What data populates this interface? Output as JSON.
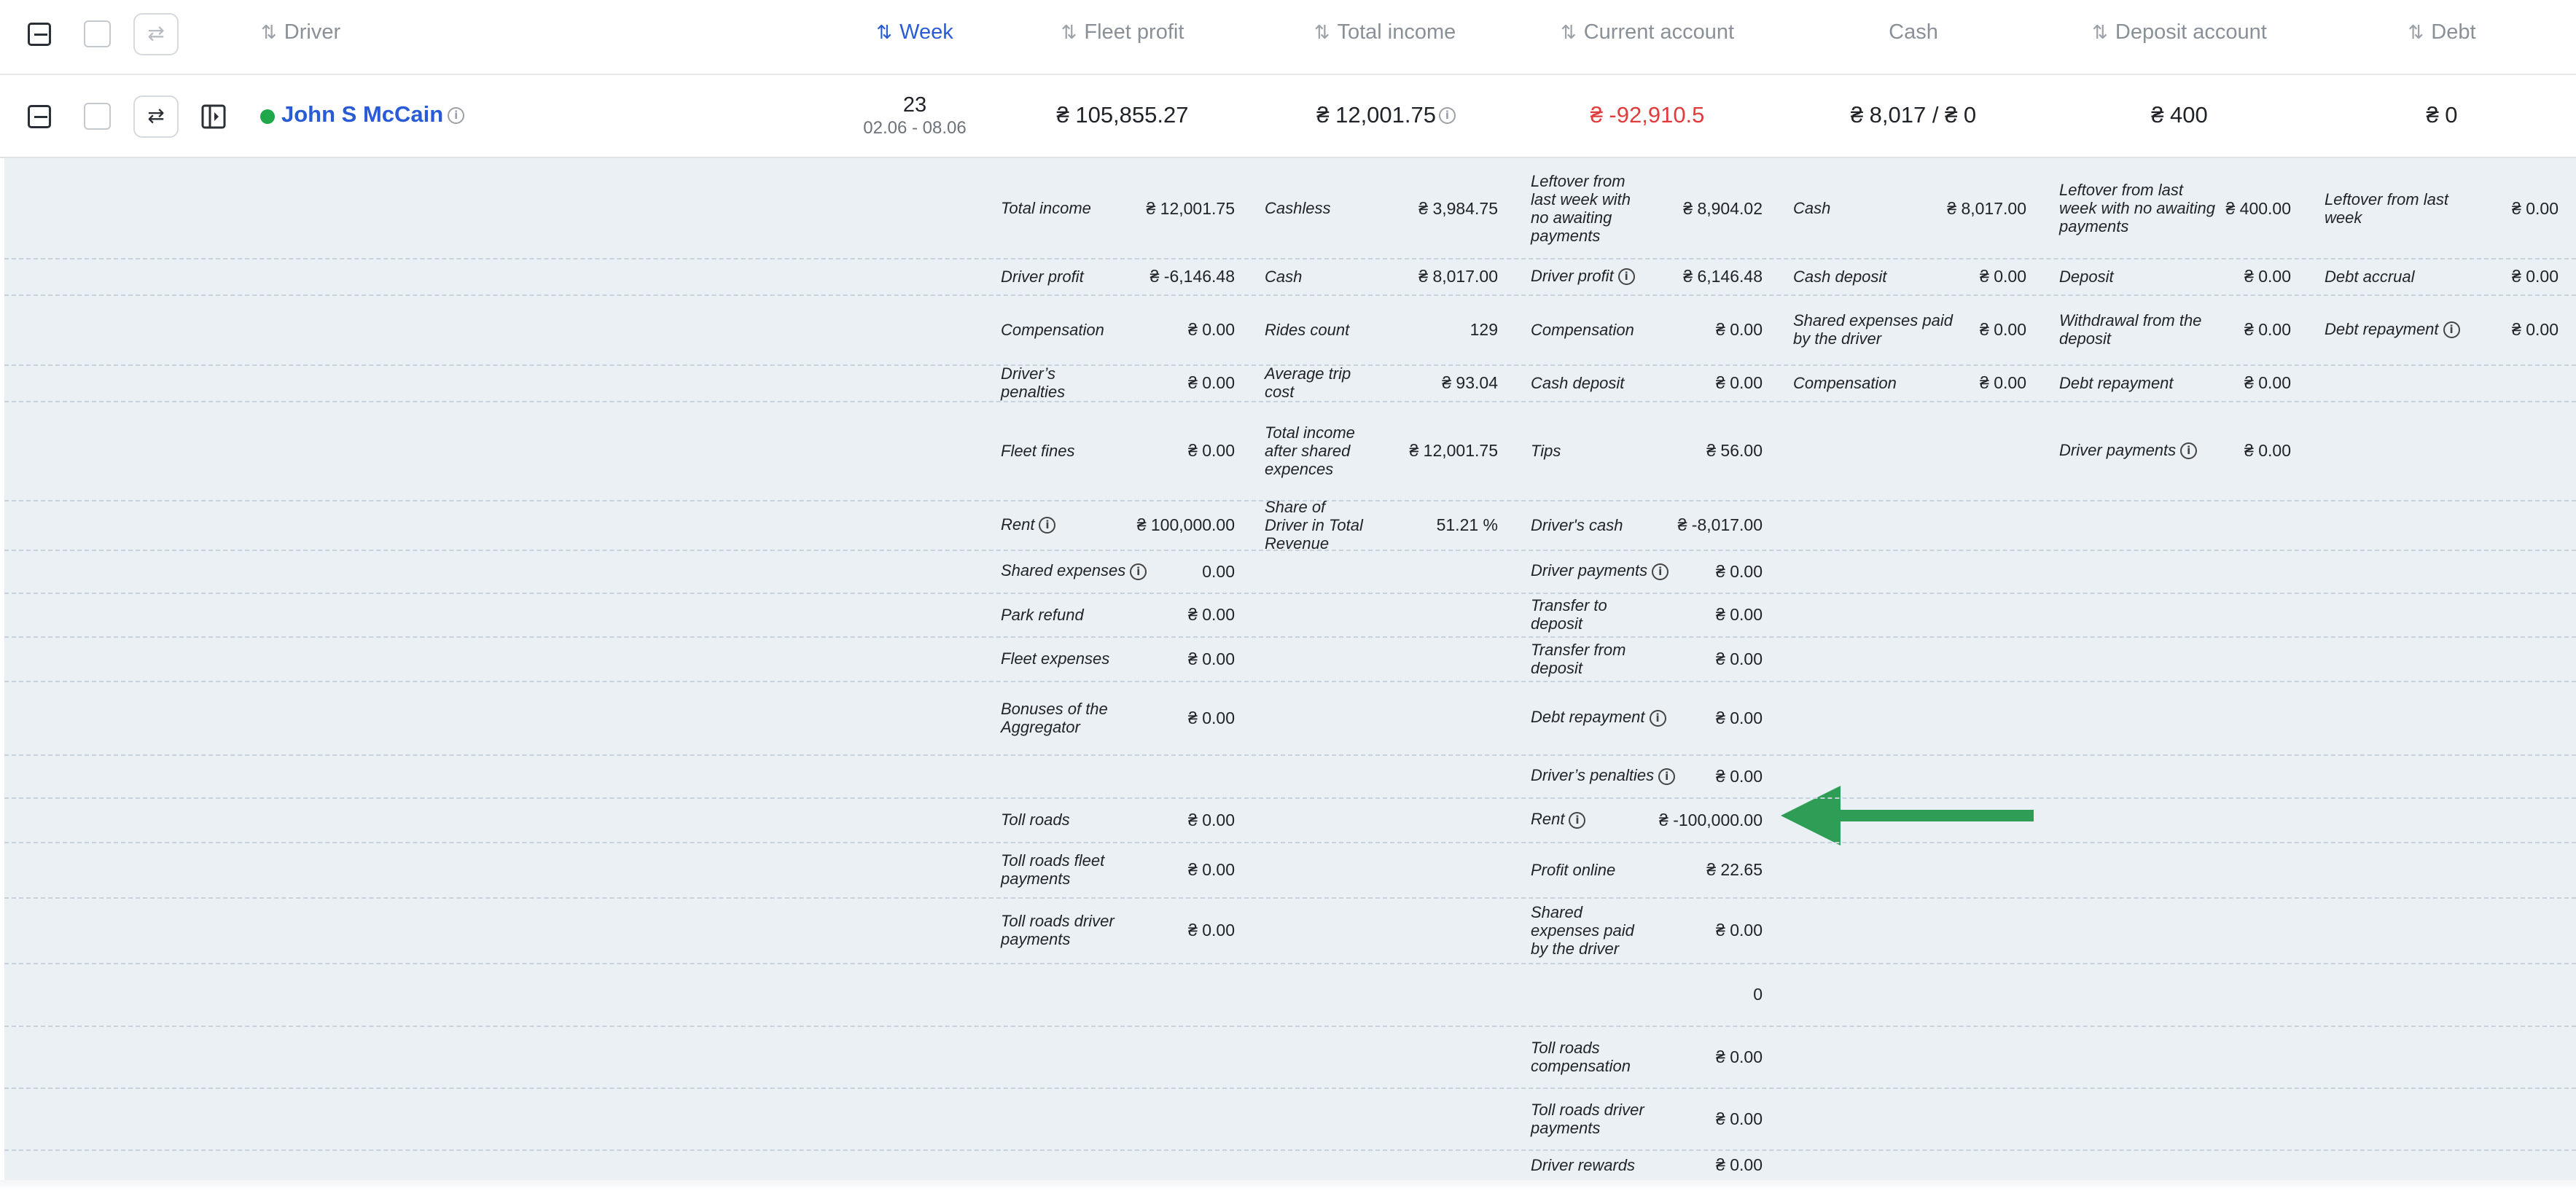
{
  "currency": "₴",
  "colors": {
    "accent": "#2a5bd7",
    "negative": "#e23b3b",
    "online_dot": "#1fa74a",
    "panel_bg": "#ebf0f5",
    "arrow": "#2e9e57"
  },
  "icons": {
    "collapse": "collapse-minus-icon",
    "swap": "swap-arrows-icon",
    "sidebar": "side-panel-icon",
    "info": "info-circle-icon",
    "sort": "sort-arrows-icon",
    "pointer": "green-arrow-left-icon"
  },
  "header": {
    "sort_glyph": "⇅",
    "columns": {
      "driver": "Driver",
      "week": "Week",
      "fleet_profit": "Fleet profit",
      "total_income": "Total income",
      "current_account": "Current account",
      "cash": "Cash",
      "deposit_account": "Deposit account",
      "debt": "Debt"
    }
  },
  "row": {
    "driver_name": "John S McCain",
    "week_number": "23",
    "week_range": "02.06 - 08.06",
    "fleet_profit": "₴ 105,855.27",
    "total_income": "₴ 12,001.75",
    "current_account": "₴ -92,910.5",
    "cash": "₴ 8,017  /  ₴ 0",
    "deposit_account": "₴ 400",
    "debt": "₴ 0"
  },
  "details": {
    "c1": [
      {
        "label": "Total income",
        "value": "₴ 12,001.75"
      },
      {
        "label": "Driver profit",
        "value": "₴ -6,146.48"
      },
      {
        "label": "Compensation",
        "value": "₴ 0.00"
      },
      {
        "label": "Driver’s penalties",
        "value": "₴ 0.00"
      },
      {
        "label": "Fleet fines",
        "value": "₴ 0.00"
      },
      {
        "label": "Rent",
        "value": "₴ 100,000.00"
      },
      {
        "label": "Shared expenses",
        "value": "0.00"
      },
      {
        "label": "Park refund",
        "value": "₴ 0.00"
      },
      {
        "label": "Fleet expenses",
        "value": "₴ 0.00"
      },
      {
        "label": "Bonuses of the Aggregator",
        "value": "₴ 0.00"
      },
      {
        "label": "Toll roads",
        "value": "₴ 0.00"
      },
      {
        "label": "Toll roads fleet payments",
        "value": "₴ 0.00"
      },
      {
        "label": "Toll roads driver payments",
        "value": "₴ 0.00"
      }
    ],
    "c2": [
      {
        "label": "Cashless",
        "value": "₴ 3,984.75"
      },
      {
        "label": "Cash",
        "value": "₴ 8,017.00"
      },
      {
        "label": "Rides count",
        "value": "129"
      },
      {
        "label": "Average trip cost",
        "value": "₴ 93.04"
      },
      {
        "label": "Total income after shared expences",
        "value": "₴ 12,001.75"
      },
      {
        "label": "Share of Driver in Total Revenue",
        "value": "51.21 %"
      }
    ],
    "c3": [
      {
        "label": "Leftover from last week with no awaiting payments",
        "value": "₴ 8,904.02"
      },
      {
        "label": "Driver profit",
        "value": "₴ 6,146.48"
      },
      {
        "label": "Compensation",
        "value": "₴ 0.00"
      },
      {
        "label": "Cash deposit",
        "value": "₴ 0.00"
      },
      {
        "label": "Tips",
        "value": "₴ 56.00"
      },
      {
        "label": "Driver's cash",
        "value": "₴ -8,017.00"
      },
      {
        "label": "Driver payments",
        "value": "₴ 0.00"
      },
      {
        "label": "Transfer to deposit",
        "value": "₴ 0.00"
      },
      {
        "label": "Transfer from deposit",
        "value": "₴ 0.00"
      },
      {
        "label": "Debt repayment",
        "value": "₴ 0.00"
      },
      {
        "label": "Driver’s penalties",
        "value": "₴ 0.00"
      },
      {
        "label": "Rent",
        "value": "₴ -100,000.00"
      },
      {
        "label": "Profit online",
        "value": "₴ 22.65"
      },
      {
        "label": "Shared expenses paid by the driver",
        "value": "₴ 0.00"
      },
      {
        "label": "",
        "value": "0"
      },
      {
        "label": "Toll roads compensation",
        "value": "₴ 0.00"
      },
      {
        "label": "Toll roads driver payments",
        "value": "₴ 0.00"
      },
      {
        "label": "Driver rewards",
        "value": "₴ 0.00"
      }
    ],
    "c4": [
      {
        "label": "Cash",
        "value": "₴ 8,017.00"
      },
      {
        "label": "Cash deposit",
        "value": "₴ 0.00"
      },
      {
        "label": "Shared expenses paid by the driver",
        "value": "₴ 0.00"
      },
      {
        "label": "Compensation",
        "value": "₴ 0.00"
      }
    ],
    "c5": [
      {
        "label": "Leftover from last week with no awaiting payments",
        "value": "₴ 400.00"
      },
      {
        "label": "Deposit",
        "value": "₴ 0.00"
      },
      {
        "label": "Withdrawal from the deposit",
        "value": "₴ 0.00"
      },
      {
        "label": "Debt repayment",
        "value": "₴ 0.00"
      },
      {
        "label": "Driver payments",
        "value": "₴ 0.00"
      }
    ],
    "c6": [
      {
        "label": "Leftover from last week",
        "value": "₴ 0.00"
      },
      {
        "label": "Debt accrual",
        "value": "₴ 0.00"
      },
      {
        "label": "Debt repayment",
        "value": "₴ 0.00"
      }
    ]
  }
}
